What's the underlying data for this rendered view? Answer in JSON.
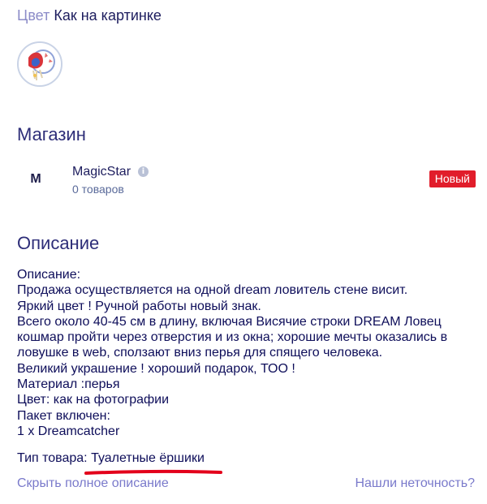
{
  "color": {
    "label": "Цвет",
    "value": "Как на картинке"
  },
  "store": {
    "heading": "Магазин",
    "avatar_letter": "M",
    "name": "MagicStar",
    "info_icon": "info-icon",
    "count": "0 товаров",
    "badge": "Новый"
  },
  "description": {
    "heading": "Описание",
    "lines": [
      "Описание:",
      "Продажа осуществляется на одной dream ловитель стене висит.",
      "Яркий цвет ! Ручной работы новый знак.",
      "Всего около 40-45 см в длину, включая Висячие строки DREAM Ловец",
      "кошмар пройти через отверстия и из окна; хорошие мечты оказались в",
      "ловушке в web, сползают вниз перья для спящего человека.",
      "Великий украшение ! хороший подарок, ТОО !",
      "Материал :перья",
      "Цвет: как на фотографии",
      "Пакет включен:",
      "1 x Dreamcatcher"
    ],
    "product_type_label": "Тип товара:",
    "product_type_value": "Туалетные ёршики"
  },
  "links": {
    "hide": "Скрыть полное описание",
    "report": "Нашли неточность?"
  },
  "colors": {
    "badge": "#e11d2b",
    "link": "#7a7acb",
    "heading": "#2d2d78",
    "underline": "#e3001b"
  }
}
